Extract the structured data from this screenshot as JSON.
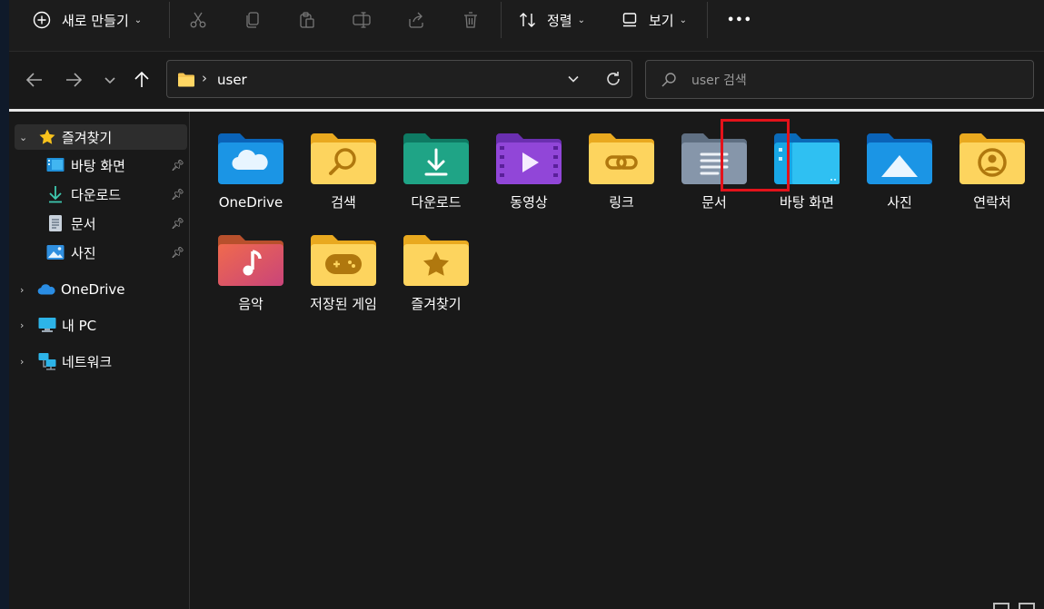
{
  "toolbar": {
    "new_label": "새로 만들기",
    "sort_label": "정렬",
    "view_label": "보기",
    "more_label": "•••"
  },
  "address": {
    "path": "user"
  },
  "search": {
    "placeholder": "user 검색"
  },
  "sidebar": {
    "quick_access": "즐겨찾기",
    "pinned": [
      {
        "label": "바탕 화면",
        "icon": "desktop-icon"
      },
      {
        "label": "다운로드",
        "icon": "download-icon"
      },
      {
        "label": "문서",
        "icon": "document-icon"
      },
      {
        "label": "사진",
        "icon": "pictures-icon"
      }
    ],
    "onedrive": "OneDrive",
    "this_pc": "내 PC",
    "network": "네트워크"
  },
  "folders": [
    {
      "label": "OneDrive",
      "icon": "onedrive-folder-icon"
    },
    {
      "label": "검색",
      "icon": "search-folder-icon"
    },
    {
      "label": "다운로드",
      "icon": "downloads-folder-icon"
    },
    {
      "label": "동영상",
      "icon": "videos-folder-icon"
    },
    {
      "label": "링크",
      "icon": "links-folder-icon"
    },
    {
      "label": "문서",
      "icon": "documents-folder-icon"
    },
    {
      "label": "바탕 화면",
      "icon": "desktop-folder-icon"
    },
    {
      "label": "사진",
      "icon": "pictures-folder-icon"
    },
    {
      "label": "연락처",
      "icon": "contacts-folder-icon"
    },
    {
      "label": "음악",
      "icon": "music-folder-icon"
    },
    {
      "label": "저장된 게임",
      "icon": "saved-games-folder-icon"
    },
    {
      "label": "즐겨찾기",
      "icon": "favorites-folder-icon"
    }
  ],
  "colors": {
    "background": "#191919",
    "folder_yellow": "#f5c451",
    "highlight_red": "#e3121a"
  }
}
